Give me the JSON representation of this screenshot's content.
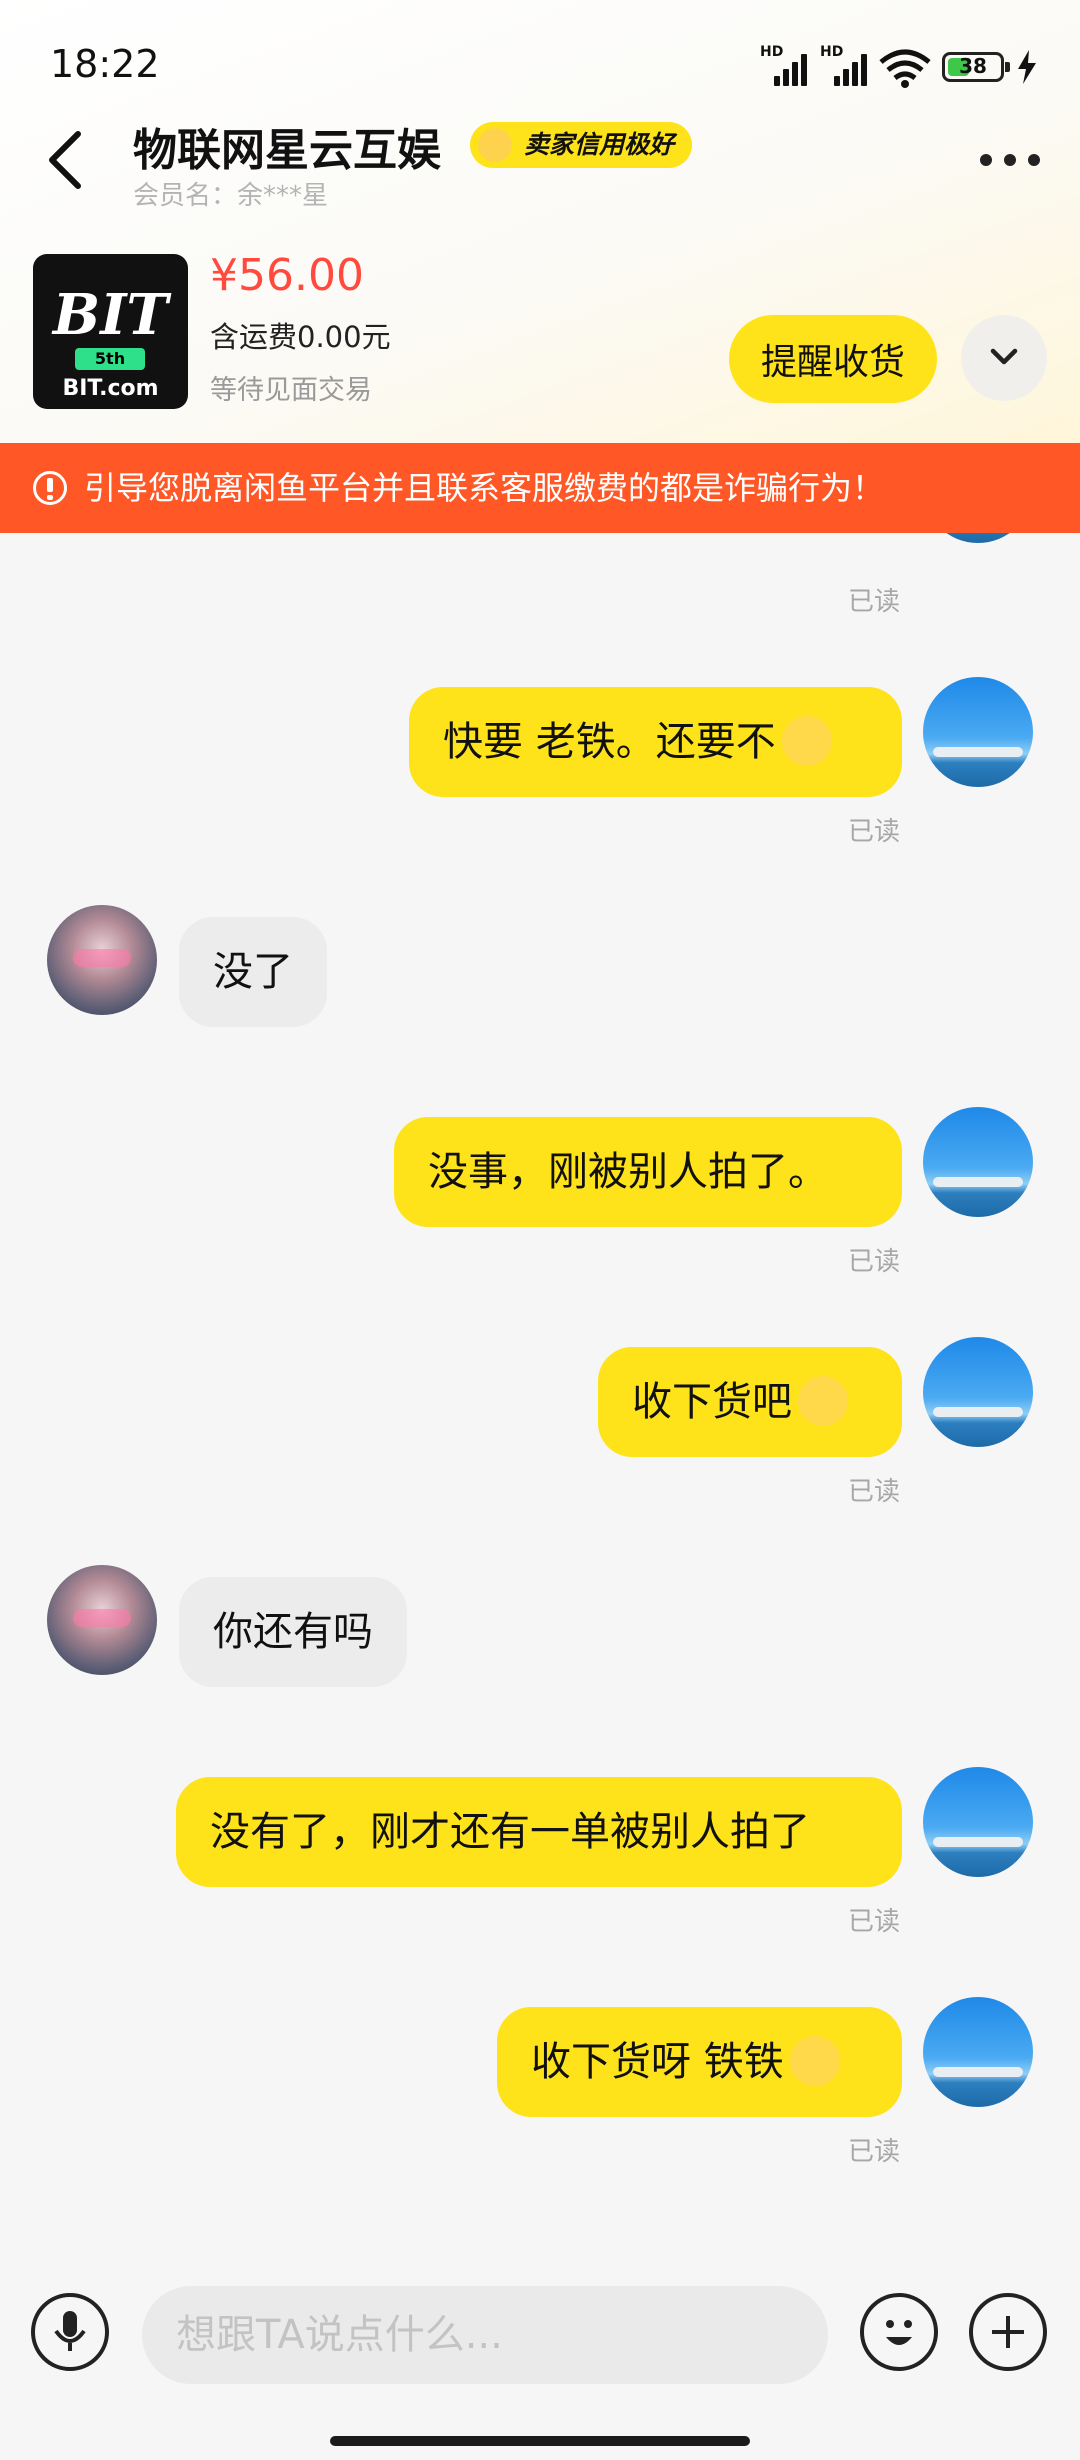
{
  "status": {
    "time": "18:22",
    "signal1": "HD",
    "signal2": "HD",
    "battery": "38"
  },
  "header": {
    "title": "物联网星云互娱",
    "credit_badge": "卖家信用极好",
    "member": "会员名：余***星"
  },
  "product": {
    "thumb_logo": "BIT",
    "thumb_badge": "5th",
    "thumb_site": "BIT.com",
    "price": "¥56.00",
    "shipping": "含运费0.00元",
    "status": "等待见面交易",
    "remind_label": "提醒收货"
  },
  "warning": "引导您脱离闲鱼平台并且联系客服缴费的都是诈骗行为！",
  "messages": [
    {
      "from": "me",
      "text": "",
      "read": "已读"
    },
    {
      "from": "me",
      "text": "快要 老铁。还要不",
      "emoji": "crying-face",
      "read": "已读"
    },
    {
      "from": "other",
      "text": "没了"
    },
    {
      "from": "me",
      "text": "没事，刚被别人拍了。",
      "read": "已读"
    },
    {
      "from": "me",
      "text": "收下货吧",
      "emoji": "person-sitting",
      "read": "已读"
    },
    {
      "from": "other",
      "text": "你还有吗"
    },
    {
      "from": "me",
      "text": "没有了，刚才还有一单被别人拍了",
      "read": "已读"
    },
    {
      "from": "me",
      "text": "收下货呀 铁铁",
      "emoji": "person-sitting",
      "read": "已读"
    }
  ],
  "input": {
    "placeholder": "想跟TA说点什么..."
  },
  "colors": {
    "accent": "#ffe31a",
    "warning": "#ff5725",
    "price": "#ff4a3d"
  }
}
